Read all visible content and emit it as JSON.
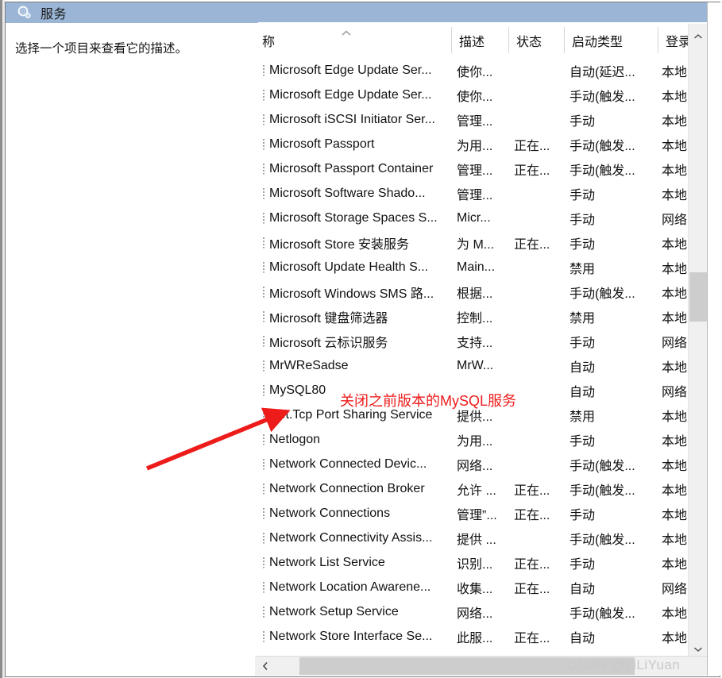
{
  "window": {
    "title": "服务",
    "icon": "services-gear-icon"
  },
  "left_pane": {
    "description_placeholder": "选择一个项目来查看它的描述。"
  },
  "list": {
    "columns": [
      {
        "key": "name",
        "label": "称"
      },
      {
        "key": "desc",
        "label": "描述"
      },
      {
        "key": "status",
        "label": "状态"
      },
      {
        "key": "start",
        "label": "启动类型"
      },
      {
        "key": "logon",
        "label": "登录"
      }
    ],
    "sort_indicator": "▲",
    "rows": [
      {
        "name": "Microsoft Edge Update Ser...",
        "desc": "使你...",
        "status": "",
        "start": "自动(延迟...",
        "logon": "本地"
      },
      {
        "name": "Microsoft Edge Update Ser...",
        "desc": "使你...",
        "status": "",
        "start": "手动(触发...",
        "logon": "本地"
      },
      {
        "name": "Microsoft iSCSI Initiator Ser...",
        "desc": "管理...",
        "status": "",
        "start": "手动",
        "logon": "本地"
      },
      {
        "name": "Microsoft Passport",
        "desc": "为用...",
        "status": "正在...",
        "start": "手动(触发...",
        "logon": "本地"
      },
      {
        "name": "Microsoft Passport Container",
        "desc": "管理...",
        "status": "正在...",
        "start": "手动(触发...",
        "logon": "本地"
      },
      {
        "name": "Microsoft Software Shado...",
        "desc": "管理...",
        "status": "",
        "start": "手动",
        "logon": "本地"
      },
      {
        "name": "Microsoft Storage Spaces S...",
        "desc": "Micr...",
        "status": "",
        "start": "手动",
        "logon": "网络"
      },
      {
        "name": "Microsoft Store 安装服务",
        "desc": "为 M...",
        "status": "正在...",
        "start": "手动",
        "logon": "本地"
      },
      {
        "name": "Microsoft Update Health S...",
        "desc": "Main...",
        "status": "",
        "start": "禁用",
        "logon": "本地"
      },
      {
        "name": "Microsoft Windows SMS 路...",
        "desc": "根据...",
        "status": "",
        "start": "手动(触发...",
        "logon": "本地"
      },
      {
        "name": "Microsoft 键盘筛选器",
        "desc": "控制...",
        "status": "",
        "start": "禁用",
        "logon": "本地"
      },
      {
        "name": "Microsoft 云标识服务",
        "desc": "支持...",
        "status": "",
        "start": "手动",
        "logon": "网络"
      },
      {
        "name": "MrWReSadse",
        "desc": "MrW...",
        "status": "",
        "start": "自动",
        "logon": "本地"
      },
      {
        "name": "MySQL80",
        "desc": "",
        "status": "",
        "start": "自动",
        "logon": "网络"
      },
      {
        "name": "Net.Tcp Port Sharing Service",
        "desc": "提供...",
        "status": "",
        "start": "禁用",
        "logon": "本地"
      },
      {
        "name": "Netlogon",
        "desc": "为用...",
        "status": "",
        "start": "手动",
        "logon": "本地"
      },
      {
        "name": "Network Connected Devic...",
        "desc": "网络...",
        "status": "",
        "start": "手动(触发...",
        "logon": "本地"
      },
      {
        "name": "Network Connection Broker",
        "desc": "允许 ...",
        "status": "正在...",
        "start": "手动(触发...",
        "logon": "本地"
      },
      {
        "name": "Network Connections",
        "desc": "管理”...",
        "status": "正在...",
        "start": "手动",
        "logon": "本地"
      },
      {
        "name": "Network Connectivity Assis...",
        "desc": "提供 ...",
        "status": "",
        "start": "手动(触发...",
        "logon": "本地"
      },
      {
        "name": "Network List Service",
        "desc": "识别...",
        "status": "正在...",
        "start": "手动",
        "logon": "本地"
      },
      {
        "name": "Network Location Awarene...",
        "desc": "收集...",
        "status": "正在...",
        "start": "自动",
        "logon": "网络"
      },
      {
        "name": "Network Setup Service",
        "desc": "网络...",
        "status": "",
        "start": "手动(触发...",
        "logon": "本地"
      },
      {
        "name": "Network Store Interface Se...",
        "desc": "此服...",
        "status": "正在...",
        "start": "自动",
        "logon": "本地"
      }
    ]
  },
  "scrollbars": {
    "vertical_up": "⌃",
    "vertical_down": "⌄",
    "horizontal_left": "‹"
  },
  "annotation": {
    "text": "关闭之前版本的MySQL服务",
    "color": "#ee1b1b",
    "arrow": "red-arrow-pointing-to-mysql80"
  },
  "watermark": {
    "text": "CSDN @LiLiYuan"
  },
  "colors": {
    "titlebar": "#9ab5d6",
    "annotation_red": "#ee1b1b",
    "scroll_thumb": "#cdcdcd",
    "scroll_track": "#f0f0f0"
  }
}
